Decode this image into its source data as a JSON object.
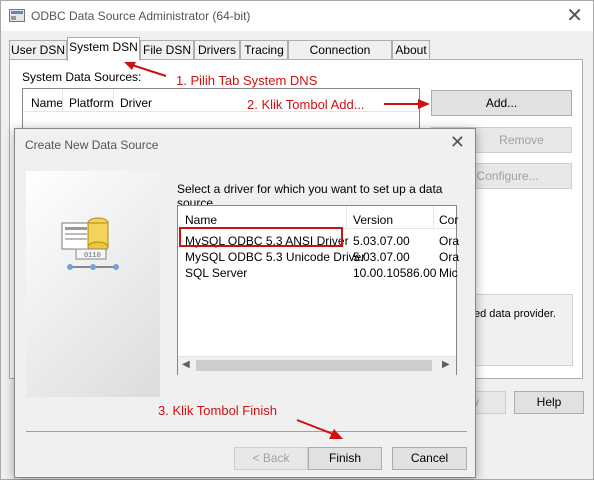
{
  "window": {
    "title": "ODBC Data Source Administrator (64-bit)",
    "close": "✕"
  },
  "tabs": [
    "User DSN",
    "System DSN",
    "File DSN",
    "Drivers",
    "Tracing",
    "Connection Pooling",
    "About"
  ],
  "system_dsn": {
    "label": "System Data Sources:",
    "columns": [
      "Name",
      "Platform",
      "Driver"
    ],
    "add": "Add...",
    "remove": "Remove",
    "configure": "Configure...",
    "info_text": "ed data provider.",
    "help": "Help",
    "ok_partial": "y"
  },
  "annotations": {
    "step1": "1. Pilih Tab System DNS",
    "step2": "2. Klik Tombol Add...",
    "step3": "3. Klik Tombol Finish",
    "color": "#d01010"
  },
  "dialog": {
    "title": "Create New Data Source",
    "close": "✕",
    "instruction": "Select a driver for which you want to set up a data source.",
    "columns": [
      "Name",
      "Version",
      "Cor"
    ],
    "rows": [
      {
        "name": "MySQL ODBC 5.3 ANSI Driver",
        "version": "5.03.07.00",
        "co": "Ora"
      },
      {
        "name": "MySQL ODBC 5.3 Unicode Driver",
        "version": "5.03.07.00",
        "co": "Ora"
      },
      {
        "name": "SQL Server",
        "version": "10.00.10586.00",
        "co": "Mic"
      }
    ],
    "back": "< Back",
    "finish": "Finish",
    "cancel": "Cancel"
  }
}
